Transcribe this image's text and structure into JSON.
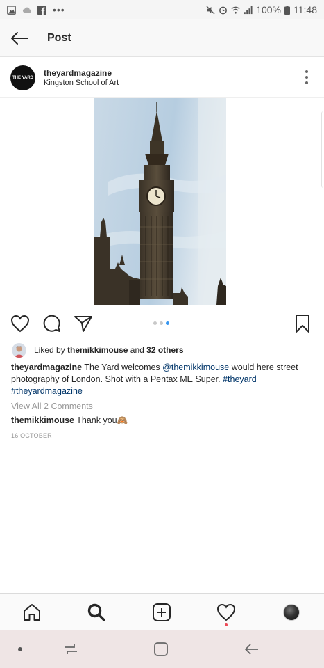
{
  "status_bar": {
    "battery": "100%",
    "time": "11:48",
    "left_icons": [
      "gallery-icon",
      "cloud-icon",
      "facebook-icon",
      "more-dots-icon"
    ],
    "right_icons": [
      "mute-icon",
      "alarm-icon",
      "wifi-icon",
      "signal-icon",
      "battery-icon"
    ]
  },
  "header": {
    "title": "Post",
    "back_icon": "arrow-left-icon"
  },
  "post": {
    "username": "theyardmagazine",
    "location": "Kingston School of Art",
    "avatar_text": "THE YARD",
    "photo_description": "Big Ben clock tower against sky",
    "carousel": {
      "count": 3,
      "active_index": 2
    }
  },
  "actions": {
    "like_icon": "heart-icon",
    "comment_icon": "comment-icon",
    "share_icon": "send-icon",
    "save_icon": "bookmark-icon"
  },
  "likes": {
    "prefix": "Liked by",
    "user": "themikkimouse",
    "middle": "and",
    "others": "32 others"
  },
  "caption": {
    "username": "theyardmagazine",
    "text_1": "The Yard welcomes",
    "mention": "@themikkimouse",
    "text_2": "would here street photography of London. Shot with a Pentax ME Super.",
    "hashtag_1": "#theyard",
    "hashtag_2": "#theyardmagazine"
  },
  "comments": {
    "view_all": "View All 2 Comments",
    "items": [
      {
        "username": "themikkimouse",
        "text": "Thank you🙈"
      }
    ]
  },
  "date": "16 OCTOBER",
  "bottom_nav": {
    "items": [
      "home-icon",
      "search-icon",
      "add-post-icon",
      "activity-heart-icon",
      "profile-avatar"
    ]
  },
  "system_nav": {
    "items": [
      "dot-icon",
      "recent-apps-icon",
      "home-square-icon",
      "back-icon"
    ]
  },
  "colors": {
    "link": "#003569",
    "carousel_active": "#3897f0",
    "notification": "#ed4956",
    "system_nav_bg": "#efe5e5"
  }
}
